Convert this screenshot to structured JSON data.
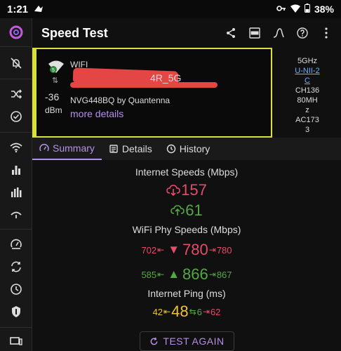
{
  "status_bar": {
    "time": "1:21",
    "battery": "38%"
  },
  "header": {
    "title": "Speed Test"
  },
  "wifi": {
    "type": "WIFI",
    "ssid_suffix": "4R_5G",
    "signal": "-36",
    "unit": "dBm",
    "ap": "NVG448BQ by Quantenna",
    "more": "more details",
    "band": {
      "freq": "5GHz",
      "band_name_1": "U-NII-2",
      "band_name_2": "C",
      "channel": "CH136",
      "width_1": "80MH",
      "width_2": "z",
      "standard_1": "AC173",
      "standard_2": "3"
    }
  },
  "tabs": [
    {
      "label": "Summary"
    },
    {
      "label": "Details"
    },
    {
      "label": "History"
    }
  ],
  "summary": {
    "internet_title": "Internet Speeds (Mbps)",
    "download": "157",
    "upload": "61",
    "phy_title": "WiFi Phy Speeds (Mbps)",
    "phy_down": {
      "min": "702",
      "cur": "780",
      "max": "780"
    },
    "phy_up": {
      "min": "585",
      "cur": "866",
      "max": "867"
    },
    "ping_title": "Internet Ping (ms)",
    "ping": {
      "min": "42",
      "cur": "48",
      "jitter": "6",
      "max": "62"
    },
    "test_again": "TEST AGAIN"
  },
  "colors": {
    "accent": "#b590e8",
    "download": "#e64b6a",
    "upload": "#54a843",
    "ping": "#f0c23b",
    "card_border": "#d9df3b"
  }
}
